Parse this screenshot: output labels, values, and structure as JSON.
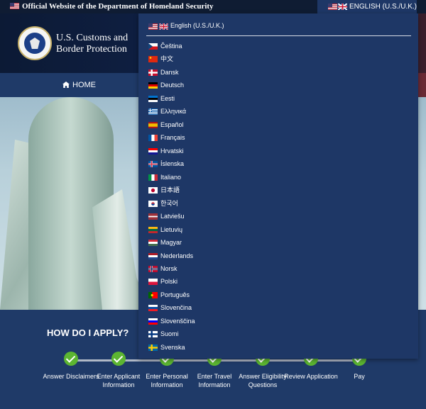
{
  "top_bar": {
    "official_text": "Official Website of the Department of Homeland Security"
  },
  "language_button": {
    "label": "ENGLISH (U.S./U.K.)"
  },
  "header": {
    "agency_line1": "U.S. Customs and",
    "agency_line2": "Border Protection"
  },
  "nav": {
    "home_label": "HOME"
  },
  "apply": {
    "title": "HOW DO I APPLY?",
    "steps": [
      {
        "label": "Answer Disclaimers",
        "completed": true
      },
      {
        "label": "Enter Applicant Information",
        "completed": true
      },
      {
        "label": "Enter Personal Information",
        "completed": true
      },
      {
        "label": "Enter Travel Information",
        "completed": true
      },
      {
        "label": "Answer Eligibility Questions",
        "completed": true
      },
      {
        "label": "Review Application",
        "completed": true
      },
      {
        "label": "Pay",
        "completed": true
      }
    ]
  },
  "language_menu": {
    "current": "English (U.S./U.K.)",
    "languages": [
      {
        "name": "Čeština",
        "flag": "cz"
      },
      {
        "name": "中文",
        "flag": "cn"
      },
      {
        "name": "Dansk",
        "flag": "dk"
      },
      {
        "name": "Deutsch",
        "flag": "de"
      },
      {
        "name": "Eesti",
        "flag": "ee"
      },
      {
        "name": "Ελληνικά",
        "flag": "gr"
      },
      {
        "name": "Español",
        "flag": "es"
      },
      {
        "name": "Français",
        "flag": "fr"
      },
      {
        "name": "Hrvatski",
        "flag": "hr"
      },
      {
        "name": "Íslenska",
        "flag": "is"
      },
      {
        "name": "Italiano",
        "flag": "it"
      },
      {
        "name": "日本語",
        "flag": "jp"
      },
      {
        "name": "한국어",
        "flag": "kr"
      },
      {
        "name": "Latviešu",
        "flag": "lv"
      },
      {
        "name": "Lietuvių",
        "flag": "lt"
      },
      {
        "name": "Magyar",
        "flag": "hu"
      },
      {
        "name": "Nederlands",
        "flag": "nl"
      },
      {
        "name": "Norsk",
        "flag": "no"
      },
      {
        "name": "Polski",
        "flag": "pl"
      },
      {
        "name": "Português",
        "flag": "pt"
      },
      {
        "name": "Slovenčina",
        "flag": "sk"
      },
      {
        "name": "Slovenščina",
        "flag": "si"
      },
      {
        "name": "Suomi",
        "flag": "fi"
      },
      {
        "name": "Svenska",
        "flag": "se"
      }
    ]
  }
}
